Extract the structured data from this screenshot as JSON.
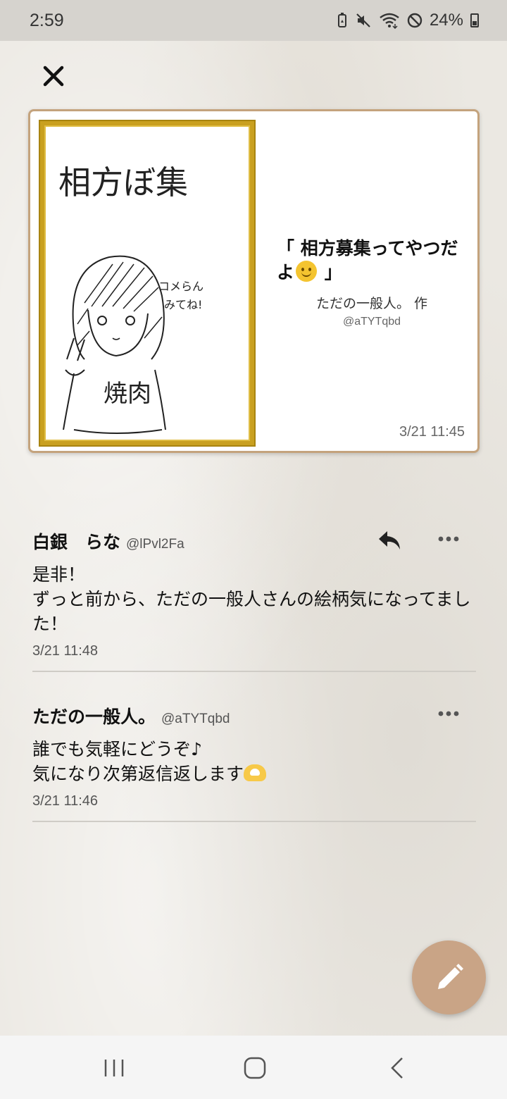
{
  "status_bar": {
    "time": "2:59",
    "battery_percent": "24%",
    "icons": [
      "battery-saver-icon",
      "mute-icon",
      "wifi-icon",
      "do-not-disturb-icon",
      "battery-icon"
    ]
  },
  "close_icon": "close-icon",
  "post": {
    "title_open": "「 相方募集ってやつだよ",
    "title_close": " 」",
    "title_emoji": "smile-emoji",
    "author": "ただの一般人。 作",
    "handle": "@aTYTqbd",
    "time": "3/21 11:45",
    "image": {
      "heading_text": "相方ぼ集",
      "note_text_line1": "コメらん",
      "note_text_line2": "みてね!",
      "shirt_text": "焼肉",
      "frame_color": "#c9a020"
    }
  },
  "comments": [
    {
      "name": "白銀　らな",
      "handle": "@lPvl2Fa",
      "body_line1": "是非！",
      "body_line2": "ずっと前から、ただの一般人さんの絵柄気になってました！",
      "time": "3/21 11:48",
      "has_reply": true
    },
    {
      "name": "ただの一般人。",
      "handle": "@aTYTqbd",
      "body_line1": "誰でも気軽にどうぞ♪",
      "body_line2": "気になり次第返信返します",
      "body_emoji": "heart-hands-emoji",
      "time": "3/21 11:46",
      "has_reply": false
    }
  ],
  "fab_icon": "pencil-icon",
  "nav": {
    "items": [
      "recent-apps-icon",
      "home-icon",
      "back-icon"
    ]
  },
  "colors": {
    "accent": "#c9a486",
    "card_border": "#c4a37d",
    "frame_gold": "#c9a020"
  }
}
